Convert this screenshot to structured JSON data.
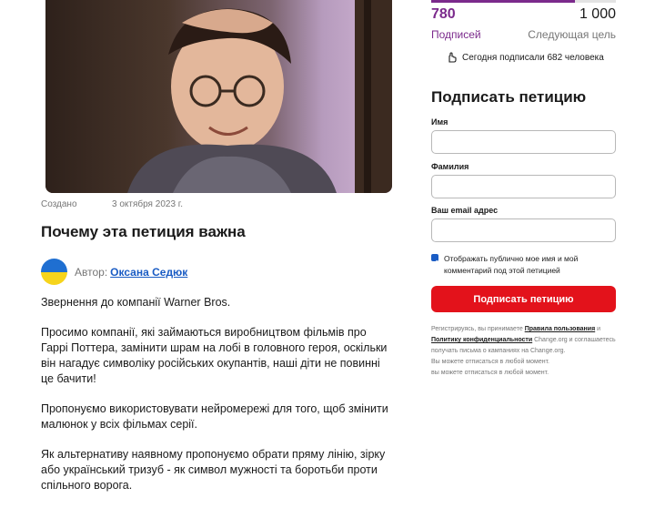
{
  "petition": {
    "created_label": "Создано",
    "created_date": "3 октября 2023 г.",
    "why_title": "Почему эта петиция важна",
    "author_prefix": "Автор:",
    "author_name": "Оксана Седюк",
    "paragraphs": [
      "Звернення до компанії Warner Bros.",
      "Просимо компанії, які займаються виробництвом фільмів про Гаррі Поттера, замінити шрам на лобі в головного героя, оскільки він нагадує символіку російських окупантів, наші діти не повинні це бачити!",
      "Пропонуємо використовувати нейромережі для того, щоб змінити малюнок у всіх фільмах серії.",
      "Як альтернативу наявному пропонуємо обрати пряму лінію, зірку або український тризуб - як символ мужності та боротьби проти спільного ворога."
    ]
  },
  "progress": {
    "signatures": "780",
    "signatures_label": "Подписей",
    "goal": "1 000",
    "goal_label": "Следующая цель",
    "fill_fraction": 0.78,
    "today_text": "Сегодня подписали 682 человека"
  },
  "sign_form": {
    "title": "Подписать петицию",
    "first_name_label": "Имя",
    "last_name_label": "Фамилия",
    "email_label": "Ваш email адрес",
    "first_name_value": "",
    "last_name_value": "",
    "email_value": "",
    "public_checkbox_label": "Отображать публично мое имя и мой комментарий под этой петицией",
    "public_checked": true,
    "submit_label": "Подписать петицию",
    "legal_prefix": "Регистрируясь, вы принимаете",
    "terms_link": "Правила пользования",
    "legal_and": "и",
    "privacy_link": "Политику конфиденциальности",
    "legal_suffix": "Change.org и соглашаетесь получать письма о кампаниях на Change.org.",
    "unsubscribe_1": "Вы можете отписаться в любой момент.",
    "unsubscribe_2": "вы можете отписаться в любой момент."
  },
  "colors": {
    "brand_purple": "#7b2a8c",
    "sign_red": "#e3121b",
    "link_blue": "#1a5cc4"
  }
}
